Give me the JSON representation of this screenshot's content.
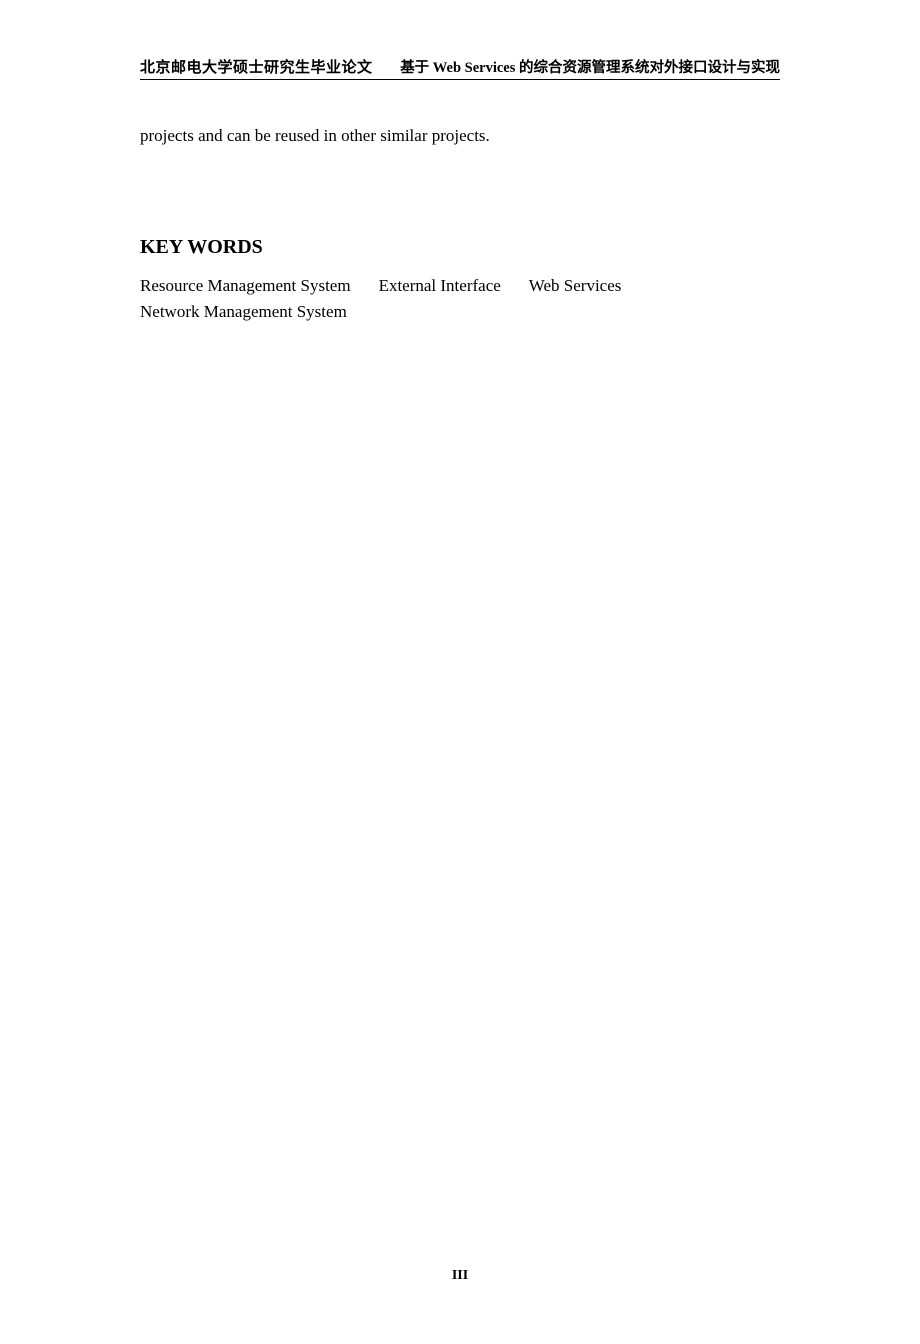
{
  "header": {
    "left": "北京邮电大学硕士研究生毕业论文",
    "right": "基于 Web Services 的综合资源管理系统对外接口设计与实现"
  },
  "body": {
    "continuation": "projects and can be reused in other similar projects."
  },
  "section": {
    "heading": "KEY WORDS"
  },
  "keywords": {
    "line1": {
      "kw1": "Resource Management System",
      "kw2": "External Interface",
      "kw3": "Web Services"
    },
    "line2": {
      "kw1": "Network Management System"
    }
  },
  "footer": {
    "page_number": "III"
  }
}
